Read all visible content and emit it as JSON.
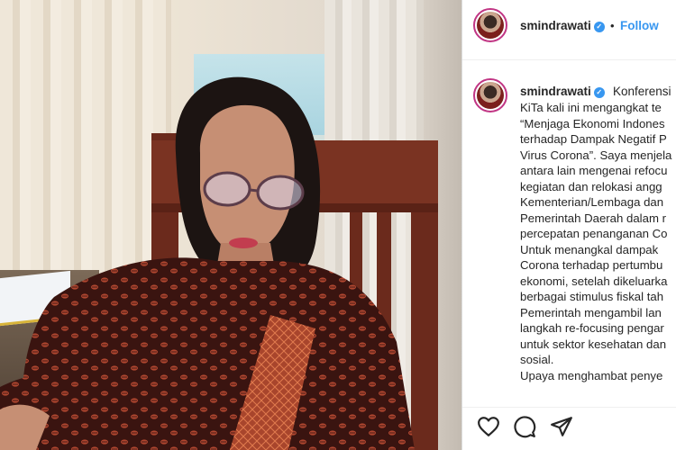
{
  "post": {
    "username": "smindrawati",
    "follow_label": "Follow",
    "dot": "•",
    "caption_first": "Konferensi",
    "caption_lines": [
      "KiTa kali ini mengangkat te",
      "“Menjaga Ekonomi Indones",
      "terhadap Dampak Negatif P",
      "Virus Corona”. Saya menjela",
      "antara lain mengenai refocu",
      "kegiatan dan relokasi angg",
      "Kementerian/Lembaga dan",
      "Pemerintah Daerah dalam r",
      "percepatan penanganan Co",
      "Untuk menangkal dampak",
      "Corona terhadap pertumbu",
      "ekonomi, setelah dikeluarka",
      "berbagai stimulus fiskal tah",
      "Pemerintah mengambil lan",
      "langkah re-focusing pengar",
      "untuk sektor kesehatan dan",
      "sosial.",
      "Upaya menghambat penye"
    ]
  },
  "icons": {
    "verified": "verified-badge-icon",
    "like": "heart-icon",
    "comment": "comment-icon",
    "share": "share-icon"
  },
  "colors": {
    "accent": "#3897f0",
    "text": "#262626",
    "border": "#dbdbdb"
  }
}
